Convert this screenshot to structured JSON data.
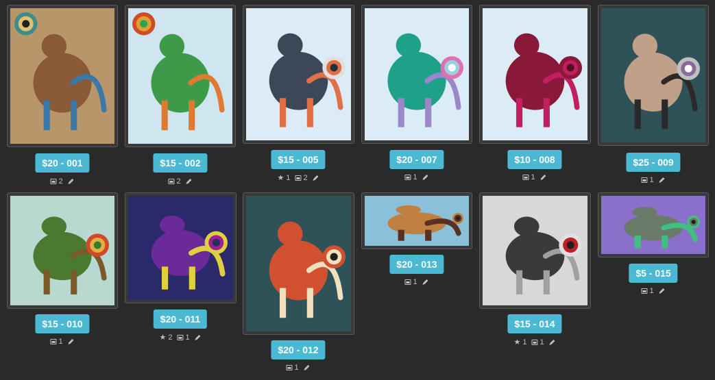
{
  "items": [
    {
      "label": "$20 - 001",
      "stars": null,
      "images": "2",
      "palette": [
        "#b8966a",
        "#8a5a38",
        "#3a78a8"
      ],
      "badge": [
        "#3c8c8c",
        "#e0c070",
        "#202020"
      ]
    },
    {
      "label": "$15 - 002",
      "stars": null,
      "images": "2",
      "palette": [
        "#cfe6f0",
        "#3c9a48",
        "#e07a30"
      ],
      "badge": [
        "#d04a2a",
        "#e0a030",
        "#30a060"
      ]
    },
    {
      "label": "$15 - 005",
      "stars": "1",
      "images": "2",
      "palette": [
        "#dcecf7",
        "#3c4858",
        "#e07048"
      ],
      "badge": [
        "#e0e0e0",
        "#e07040",
        "#203040"
      ]
    },
    {
      "label": "$20 - 007",
      "stars": null,
      "images": "1",
      "palette": [
        "#dcecf7",
        "#1fa088",
        "#9a86c8"
      ],
      "badge": [
        "#e070b0",
        "#9ad0e0",
        "#ffffff"
      ]
    },
    {
      "label": "$10 - 008",
      "stars": null,
      "images": "1",
      "palette": [
        "#dcecf7",
        "#8a1838",
        "#c02060"
      ],
      "badge": [
        "#8a1838",
        "#c02060",
        "#501020"
      ]
    },
    {
      "label": "$25 - 009",
      "stars": null,
      "images": "1",
      "palette": [
        "#2f5258",
        "#c0a088",
        "#2a2a2a"
      ],
      "badge": [
        "#c0c0c0",
        "#8a6a9a",
        "#ffffff"
      ]
    },
    {
      "label": "$15 - 010",
      "stars": null,
      "images": "1",
      "palette": [
        "#b8d8d0",
        "#4a7a30",
        "#7a5a28"
      ],
      "badge": [
        "#d04a2a",
        "#e0b040",
        "#3a7a30"
      ]
    },
    {
      "label": "$20 - 011",
      "stars": "2",
      "images": "1",
      "palette": [
        "#2a2a6a",
        "#6a2a9a",
        "#e0d040"
      ],
      "badge": [
        "#e0d040",
        "#a02090",
        "#203060"
      ]
    },
    {
      "label": "$20 - 012",
      "stars": null,
      "images": "1",
      "palette": [
        "#2f5258",
        "#d05030",
        "#f0e0c0"
      ],
      "badge": [
        "#d05030",
        "#f0e0c0",
        "#202020"
      ]
    },
    {
      "label": "$20 - 013",
      "stars": null,
      "images": "1",
      "palette": [
        "#8ac0d8",
        "#c08040",
        "#5a3020"
      ],
      "badge": [
        "#c08040",
        "#5a3020",
        "#202020"
      ]
    },
    {
      "label": "$15 - 014",
      "stars": "1",
      "images": "1",
      "palette": [
        "#d8d8d8",
        "#3a3a3a",
        "#a0a0a0"
      ],
      "badge": [
        "#e0e0e0",
        "#c02020",
        "#202020"
      ]
    },
    {
      "label": "$5 - 015",
      "stars": null,
      "images": "1",
      "palette": [
        "#8a70c8",
        "#6a7a68",
        "#40c080"
      ],
      "badge": [
        "#40c080",
        "#6a7a68",
        "#202020"
      ]
    }
  ]
}
